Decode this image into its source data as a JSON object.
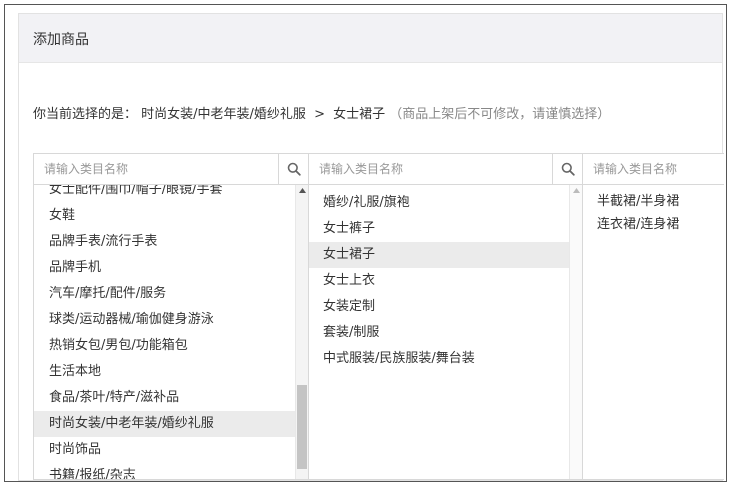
{
  "header": {
    "title": "添加商品"
  },
  "selection": {
    "prefix": "你当前选择的是：",
    "path": "时尚女装/中老年装/婚纱礼服",
    "separator": ">",
    "leaf": "女士裙子",
    "note": "（商品上架后不可修改，请谨慎选择）"
  },
  "columns": [
    {
      "placeholder": "请输入类目名称",
      "search_icon": "search-icon",
      "items": [
        "女士配件/围巾/帽子/眼镜/手套",
        "女鞋",
        "品牌手表/流行手表",
        "品牌手机",
        "汽车/摩托/配件/服务",
        "球类/运动器械/瑜伽健身游泳",
        "热销女包/男包/功能箱包",
        "生活本地",
        "食品/茶叶/特产/滋补品",
        "时尚女装/中老年装/婚纱礼服",
        "时尚饰品",
        "书籍/报纸/杂志"
      ],
      "selected_index": 9
    },
    {
      "placeholder": "请输入类目名称",
      "search_icon": "search-icon",
      "items": [
        "婚纱/礼服/旗袍",
        "女士裤子",
        "女士裙子",
        "女士上衣",
        "女装定制",
        "套装/制服",
        "中式服装/民族服装/舞台装"
      ],
      "selected_index": 2
    },
    {
      "placeholder": "请输入类目名称",
      "items": [
        "半截裙/半身裙",
        "连衣裙/连身裙"
      ]
    }
  ],
  "colors": {
    "header_bg": "#f2f2f5",
    "selected_bg": "#ebebeb",
    "border": "#d8d8d8",
    "note_text": "#888888"
  }
}
